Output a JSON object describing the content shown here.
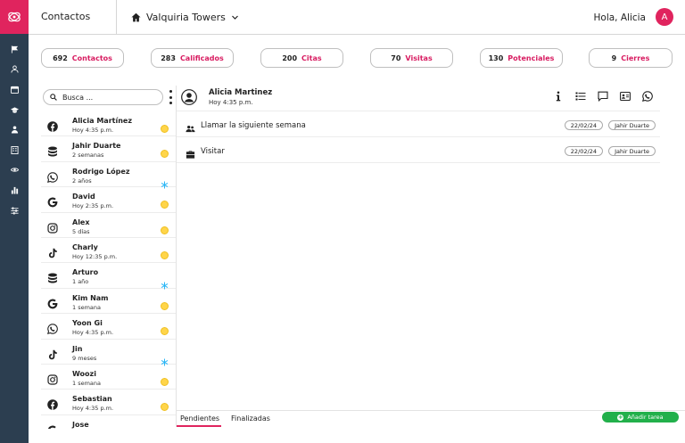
{
  "header": {
    "title": "Contactos",
    "project": "Valquiria Towers",
    "greeting": "Hola, Alicia",
    "avatar_initial": "A"
  },
  "colors": {
    "accent": "#e0245e",
    "rail": "#2c3e50",
    "success": "#22b04b",
    "warm": "#ffd54a",
    "cold": "#29b6f6"
  },
  "sidebar": {
    "icons": [
      "flag-icon",
      "user-icon",
      "calendar-icon",
      "graduation-cap-icon",
      "user-tie-icon",
      "building-icon",
      "eye-icon",
      "bar-chart-icon",
      "sliders-icon"
    ]
  },
  "stats": [
    {
      "num": "692",
      "label": "Contactos"
    },
    {
      "num": "283",
      "label": "Calificados"
    },
    {
      "num": "200",
      "label": "Citas"
    },
    {
      "num": "70",
      "label": "Visitas"
    },
    {
      "num": "130",
      "label": "Potenciales"
    },
    {
      "num": "9",
      "label": "Cierres"
    }
  ],
  "search": {
    "placeholder": "Busca ..."
  },
  "contacts": [
    {
      "name": "Alicia Martínez",
      "time": "Hoy 4:35 p.m.",
      "source": "facebook",
      "temp": "warm"
    },
    {
      "name": "Jahir Duarte",
      "time": "2 semanas",
      "source": "database",
      "temp": "warm"
    },
    {
      "name": "Rodrigo López",
      "time": "2 años",
      "source": "whatsapp",
      "temp": "cold"
    },
    {
      "name": "David",
      "time": "Hoy 2:35 p.m.",
      "source": "google",
      "temp": "warm"
    },
    {
      "name": "Alex",
      "time": "5 días",
      "source": "instagram",
      "temp": "warm"
    },
    {
      "name": "Charly",
      "time": "Hoy 12:35 p.m.",
      "source": "tiktok",
      "temp": "warm"
    },
    {
      "name": "Arturo",
      "time": "1 año",
      "source": "database",
      "temp": "cold"
    },
    {
      "name": "Kim Nam",
      "time": "1 semana",
      "source": "google",
      "temp": "warm"
    },
    {
      "name": "Yoon Gi",
      "time": "Hoy 4:35 p.m.",
      "source": "whatsapp",
      "temp": "warm"
    },
    {
      "name": "Jin",
      "time": "9 meses",
      "source": "tiktok",
      "temp": "cold"
    },
    {
      "name": "Woozi",
      "time": "1 semana",
      "source": "instagram",
      "temp": "warm"
    },
    {
      "name": "Sebastian",
      "time": "Hoy 4:35 p.m.",
      "source": "facebook",
      "temp": "warm"
    },
    {
      "name": "Jose",
      "time": "",
      "source": "google",
      "temp": "none"
    }
  ],
  "detail": {
    "name": "Alicia Martinez",
    "time": "Hoy 4:35 p.m.",
    "tasks": [
      {
        "icon": "group-icon",
        "label": "Llamar la siguiente semana",
        "date": "22/02/24",
        "user": "Jahir Duarte"
      },
      {
        "icon": "briefcase-icon",
        "label": "Visitar",
        "date": "22/02/24",
        "user": "Jahir Duarte"
      }
    ]
  },
  "tabs": {
    "pending": "Pendientes",
    "done": "Finalizadas"
  },
  "add_task_label": "Añadir tarea"
}
